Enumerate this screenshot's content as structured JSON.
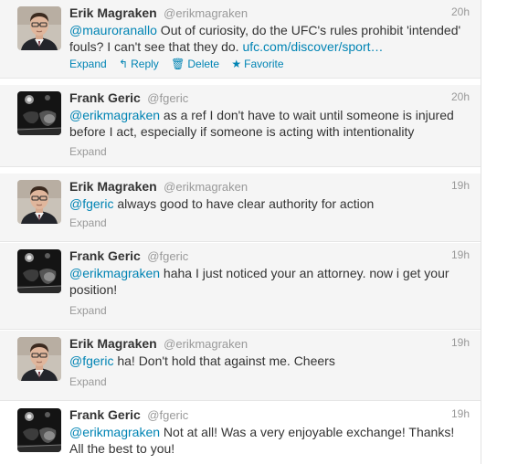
{
  "tweets": [
    {
      "fullname": "Erik Magraken",
      "username": "@erikmagraken",
      "time": "20h",
      "mention": "@mauroranallo",
      "text": " Out of curiosity, do the UFC's rules prohibit 'intended' fouls? I can't see that they do. ",
      "link": "ufc.com/discover/sport…",
      "actions": {
        "expand": "Expand",
        "reply": "Reply",
        "delete": "Delete",
        "favorite": "Favorite"
      }
    },
    {
      "fullname": "Frank Geric",
      "username": "@fgeric",
      "time": "20h",
      "mention": "@erikmagraken",
      "text": " as a ref I don't have to wait until someone is injured before I act, especially if someone is acting with intentionality",
      "expand": "Expand"
    },
    {
      "fullname": "Erik Magraken",
      "username": "@erikmagraken",
      "time": "19h",
      "mention": "@fgeric",
      "text": " always good to have clear authority for action",
      "expand": "Expand"
    },
    {
      "fullname": "Frank Geric",
      "username": "@fgeric",
      "time": "19h",
      "mention": "@erikmagraken",
      "text": " haha I just noticed your an attorney. now i get your position!",
      "expand": "Expand"
    },
    {
      "fullname": "Erik Magraken",
      "username": "@erikmagraken",
      "time": "19h",
      "mention": "@fgeric",
      "text": " ha! Don't hold that against me. Cheers",
      "expand": "Expand"
    },
    {
      "fullname": "Frank Geric",
      "username": "@fgeric",
      "time": "19h",
      "mention": "@erikmagraken",
      "text": " Not at all! Was a very enjoyable exchange! Thanks! All the best to you!"
    }
  ],
  "icons": {
    "reply": "reply-icon",
    "delete": "trash-icon",
    "favorite": "star-icon"
  },
  "colors": {
    "link": "#0084b4",
    "name": "#333333",
    "meta": "#999999",
    "highlight_bg": "#f5f5f5"
  }
}
